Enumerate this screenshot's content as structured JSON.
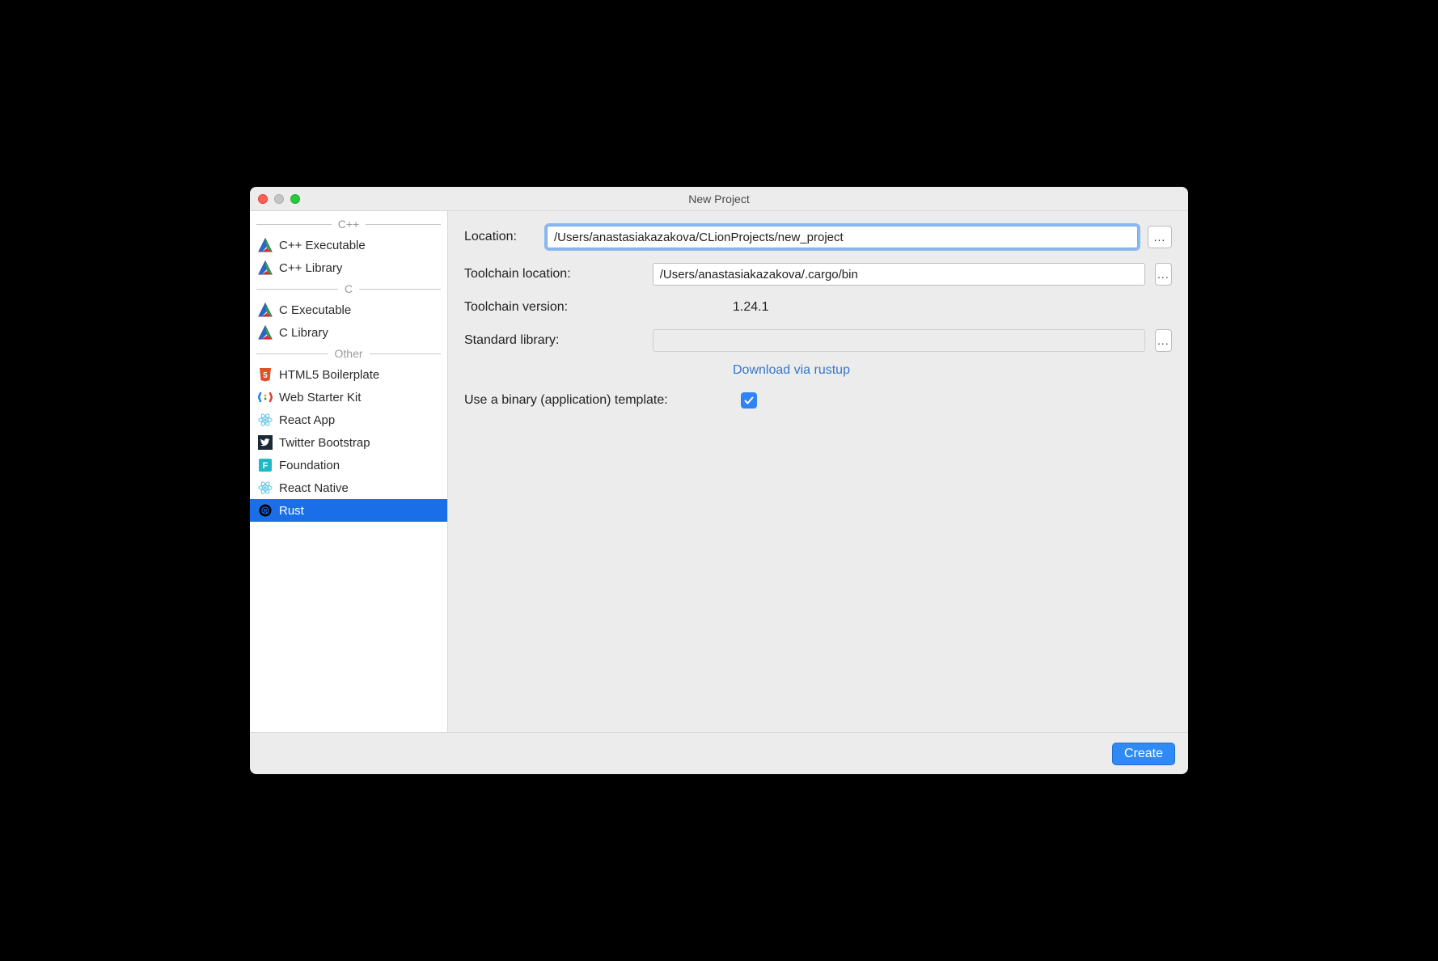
{
  "window": {
    "title": "New Project"
  },
  "sidebar": {
    "groups": [
      {
        "label": "C++",
        "items": [
          {
            "label": "C++ Executable"
          },
          {
            "label": "C++ Library"
          }
        ]
      },
      {
        "label": "C",
        "items": [
          {
            "label": "C Executable"
          },
          {
            "label": "C Library"
          }
        ]
      },
      {
        "label": "Other",
        "items": [
          {
            "label": "HTML5 Boilerplate"
          },
          {
            "label": "Web Starter Kit"
          },
          {
            "label": "React App"
          },
          {
            "label": "Twitter Bootstrap"
          },
          {
            "label": "Foundation"
          },
          {
            "label": "React Native"
          },
          {
            "label": "Rust",
            "selected": true
          }
        ]
      }
    ]
  },
  "form": {
    "location_label": "Location:",
    "location_value": "/Users/anastasiakazakova/CLionProjects/new_project",
    "toolchain_location_label": "Toolchain location:",
    "toolchain_location_value": "/Users/anastasiakazakova/.cargo/bin",
    "toolchain_version_label": "Toolchain version:",
    "toolchain_version_value": "1.24.1",
    "stdlib_label": "Standard library:",
    "stdlib_value": "",
    "download_link": "Download via rustup",
    "binary_template_label": "Use a binary (application) template:",
    "binary_template_checked": true,
    "browse_glyph": "..."
  },
  "footer": {
    "create_label": "Create"
  }
}
